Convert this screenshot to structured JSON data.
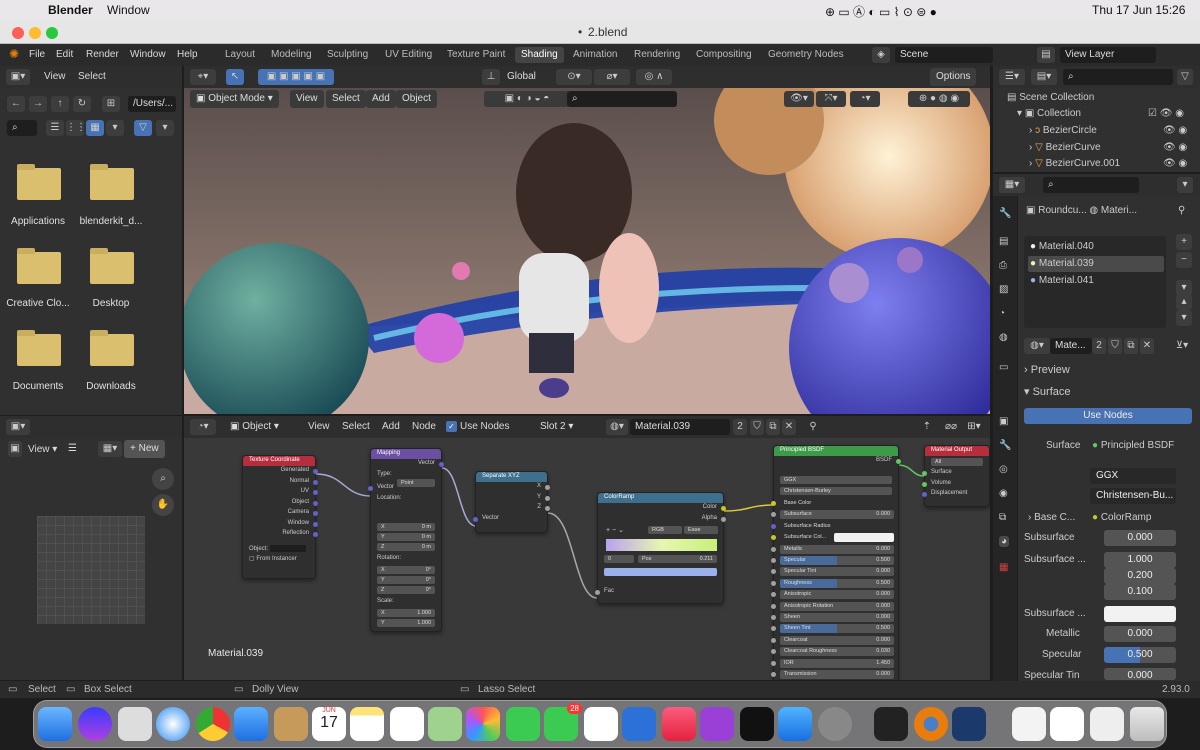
{
  "macbar": {
    "app": "Blender",
    "menu": "Window",
    "clock": "Thu 17 Jun  15:26"
  },
  "window": {
    "title": "2.blend"
  },
  "topmenu": [
    "File",
    "Edit",
    "Render",
    "Window",
    "Help"
  ],
  "workspaces": [
    "Layout",
    "Modeling",
    "Sculpting",
    "UV Editing",
    "Texture Paint",
    "Shading",
    "Animation",
    "Rendering",
    "Compositing",
    "Geometry Nodes"
  ],
  "active_workspace": "Shading",
  "scene": "Scene",
  "view_layer": "View Layer",
  "filebrowser": {
    "view": "View",
    "select": "Select",
    "path": "/Users/...",
    "folders": [
      "Applications",
      "blenderkit_d...",
      "Creative Clo...",
      "Desktop",
      "Documents",
      "Downloads"
    ]
  },
  "viewport": {
    "orientation": "Global",
    "options": "Options",
    "mode": "Object Mode",
    "menus": [
      "View",
      "Select",
      "Add",
      "Object"
    ]
  },
  "imageeditor": {
    "view": "View",
    "new": "New"
  },
  "nodeeditor": {
    "type": "Object",
    "menus": [
      "View",
      "Select",
      "Add",
      "Node"
    ],
    "use_nodes": "Use Nodes",
    "slot": "Slot 2",
    "material": "Material.039",
    "users": "2",
    "label": "Material.039"
  },
  "nodes": {
    "texcoord": {
      "title": "Texture Coordinate",
      "outs": [
        "Generated",
        "Normal",
        "UV",
        "Object",
        "Camera",
        "Window",
        "Reflection"
      ],
      "object": "Object:",
      "from_instancer": "From Instancer"
    },
    "mapping": {
      "title": "Mapping",
      "vector_out": "Vector",
      "type_label": "Type:",
      "type": "Point",
      "vector_in": "Vector",
      "location": "Location:",
      "loc": [
        "0 m",
        "0 m",
        "0 m"
      ],
      "rotation": "Rotation:",
      "rot": [
        "0°",
        "0°",
        "0°"
      ],
      "scale": "Scale:",
      "scl": [
        "1.000",
        "1.000",
        "1.000"
      ],
      "axes": [
        "X",
        "Y",
        "Z"
      ]
    },
    "separate": {
      "title": "Separate XYZ",
      "outs": [
        "X",
        "Y",
        "Z"
      ],
      "in": "Vector"
    },
    "ramp": {
      "title": "ColorRamp",
      "outs": [
        "Color",
        "Alpha"
      ],
      "mode": "RGB",
      "interp": "Ease",
      "index": "0",
      "pos_label": "Pos",
      "pos": "0.211",
      "in": "Fac"
    },
    "bsdf": {
      "title": "Principled BSDF",
      "out": "BSDF",
      "dist": "GGX",
      "sss": "Christensen-Burley",
      "rows": [
        [
          "Base Color",
          ""
        ],
        [
          "Subsurface",
          "0.000"
        ],
        [
          "Subsurface Radius",
          ""
        ],
        [
          "Subsurface Col...",
          ""
        ],
        [
          "Metallic",
          "0.000"
        ],
        [
          "Specular",
          "0.500"
        ],
        [
          "Specular Tint",
          "0.000"
        ],
        [
          "Roughness",
          "0.500"
        ],
        [
          "Anisotropic",
          "0.000"
        ],
        [
          "Anisotropic Rotation",
          "0.000"
        ],
        [
          "Sheen",
          "0.000"
        ],
        [
          "Sheen Tint",
          "0.500"
        ],
        [
          "Clearcoat",
          "0.000"
        ],
        [
          "Clearcoat Roughness",
          "0.030"
        ],
        [
          "IOR",
          "1.450"
        ],
        [
          "Transmission",
          "0.000"
        ]
      ]
    },
    "output": {
      "title": "Material Output",
      "target": "All",
      "ins": [
        "Surface",
        "Volume",
        "Displacement"
      ]
    }
  },
  "outliner": {
    "root": "Scene Collection",
    "collection": "Collection",
    "items": [
      "BezierCircle",
      "BezierCurve",
      "BezierCurve.001"
    ]
  },
  "properties": {
    "breadcrumb_obj": "Roundcu...",
    "breadcrumb_mat": "Materi...",
    "materials": [
      "Material.040",
      "Material.039",
      "Material.041"
    ],
    "selected_material": "Material.039",
    "mat_name": "Mate...",
    "mat_users": "2",
    "preview": "Preview",
    "surface": "Surface",
    "use_nodes": "Use Nodes",
    "surface_label": "Surface",
    "surface_val": "Principled BSDF",
    "dist": "GGX",
    "sss": "Christensen-Bu...",
    "base_label": "Base C...",
    "base_val": "ColorRamp",
    "sub_label": "Subsurface",
    "sub_val": "0.000",
    "subr_label": "Subsurface ...",
    "subr": [
      "1.000",
      "0.200",
      "0.100"
    ],
    "subc_label": "Subsurface ...",
    "metal_label": "Metallic",
    "metal_val": "0.000",
    "spec_label": "Specular",
    "spec_val": "0.500",
    "spect_label": "Specular Tin",
    "spect_val": "0.000"
  },
  "statusbar": {
    "select": "Select",
    "box": "Box Select",
    "dolly": "Dolly View",
    "lasso": "Lasso Select",
    "version": "2.93.0"
  },
  "dock": {
    "calendar_month": "JUN",
    "calendar_day": "17",
    "messages_badge": "28"
  }
}
